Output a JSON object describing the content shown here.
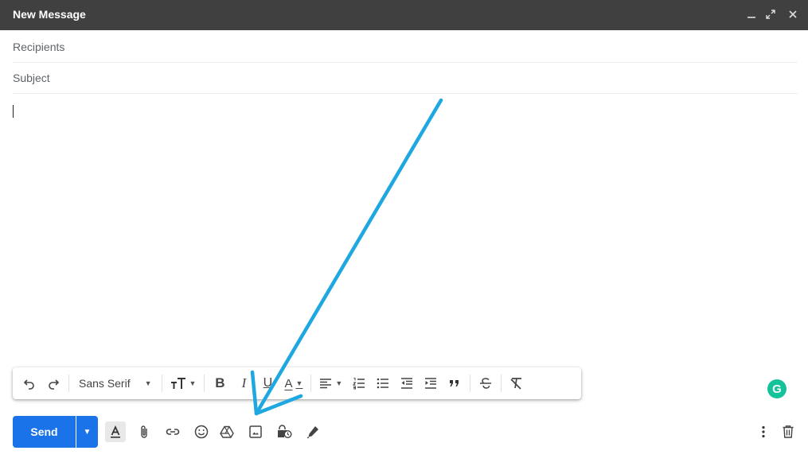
{
  "window": {
    "title": "New Message",
    "minimize_glyph": "_",
    "expand_glyph": "⤢",
    "close_glyph": "✕"
  },
  "fields": {
    "recipients_placeholder": "Recipients",
    "subject_placeholder": "Subject"
  },
  "format_bar": {
    "font_family": "Sans Serif",
    "bold_label": "B",
    "italic_label": "I",
    "underline_label": "U",
    "text_color_label": "A"
  },
  "compose": {
    "send_label": "Send",
    "grammarly_label": "G"
  },
  "colors": {
    "send_button": "#1a73e8",
    "title_bar": "#404040",
    "annotation_arrow": "#1ea7e1",
    "grammarly": "#15c39a"
  },
  "annotation": {
    "points_to": "insert-photo-icon"
  }
}
